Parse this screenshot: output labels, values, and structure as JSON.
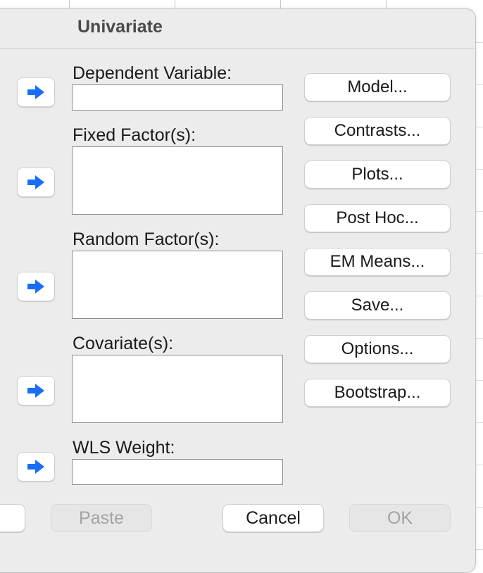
{
  "dialog": {
    "title": "Univariate"
  },
  "fields": {
    "dependent_label": "Dependent Variable:",
    "dependent_value": "",
    "fixed_label": "Fixed Factor(s):",
    "random_label": "Random Factor(s):",
    "covariate_label": "Covariate(s):",
    "wls_label": "WLS Weight:",
    "wls_value": ""
  },
  "side_buttons": {
    "model": "Model...",
    "contrasts": "Contrasts...",
    "plots": "Plots...",
    "post_hoc": "Post Hoc...",
    "em_means": "EM Means...",
    "save": "Save...",
    "options": "Options...",
    "bootstrap": "Bootstrap..."
  },
  "bottom_buttons": {
    "paste": "Paste",
    "cancel": "Cancel",
    "ok": "OK"
  },
  "icons": {
    "move_arrow": "right-arrow-icon"
  },
  "colors": {
    "arrow_blue": "#1a6ef5",
    "dialog_bg": "#ececec",
    "disabled_text": "#a3a3a3"
  }
}
